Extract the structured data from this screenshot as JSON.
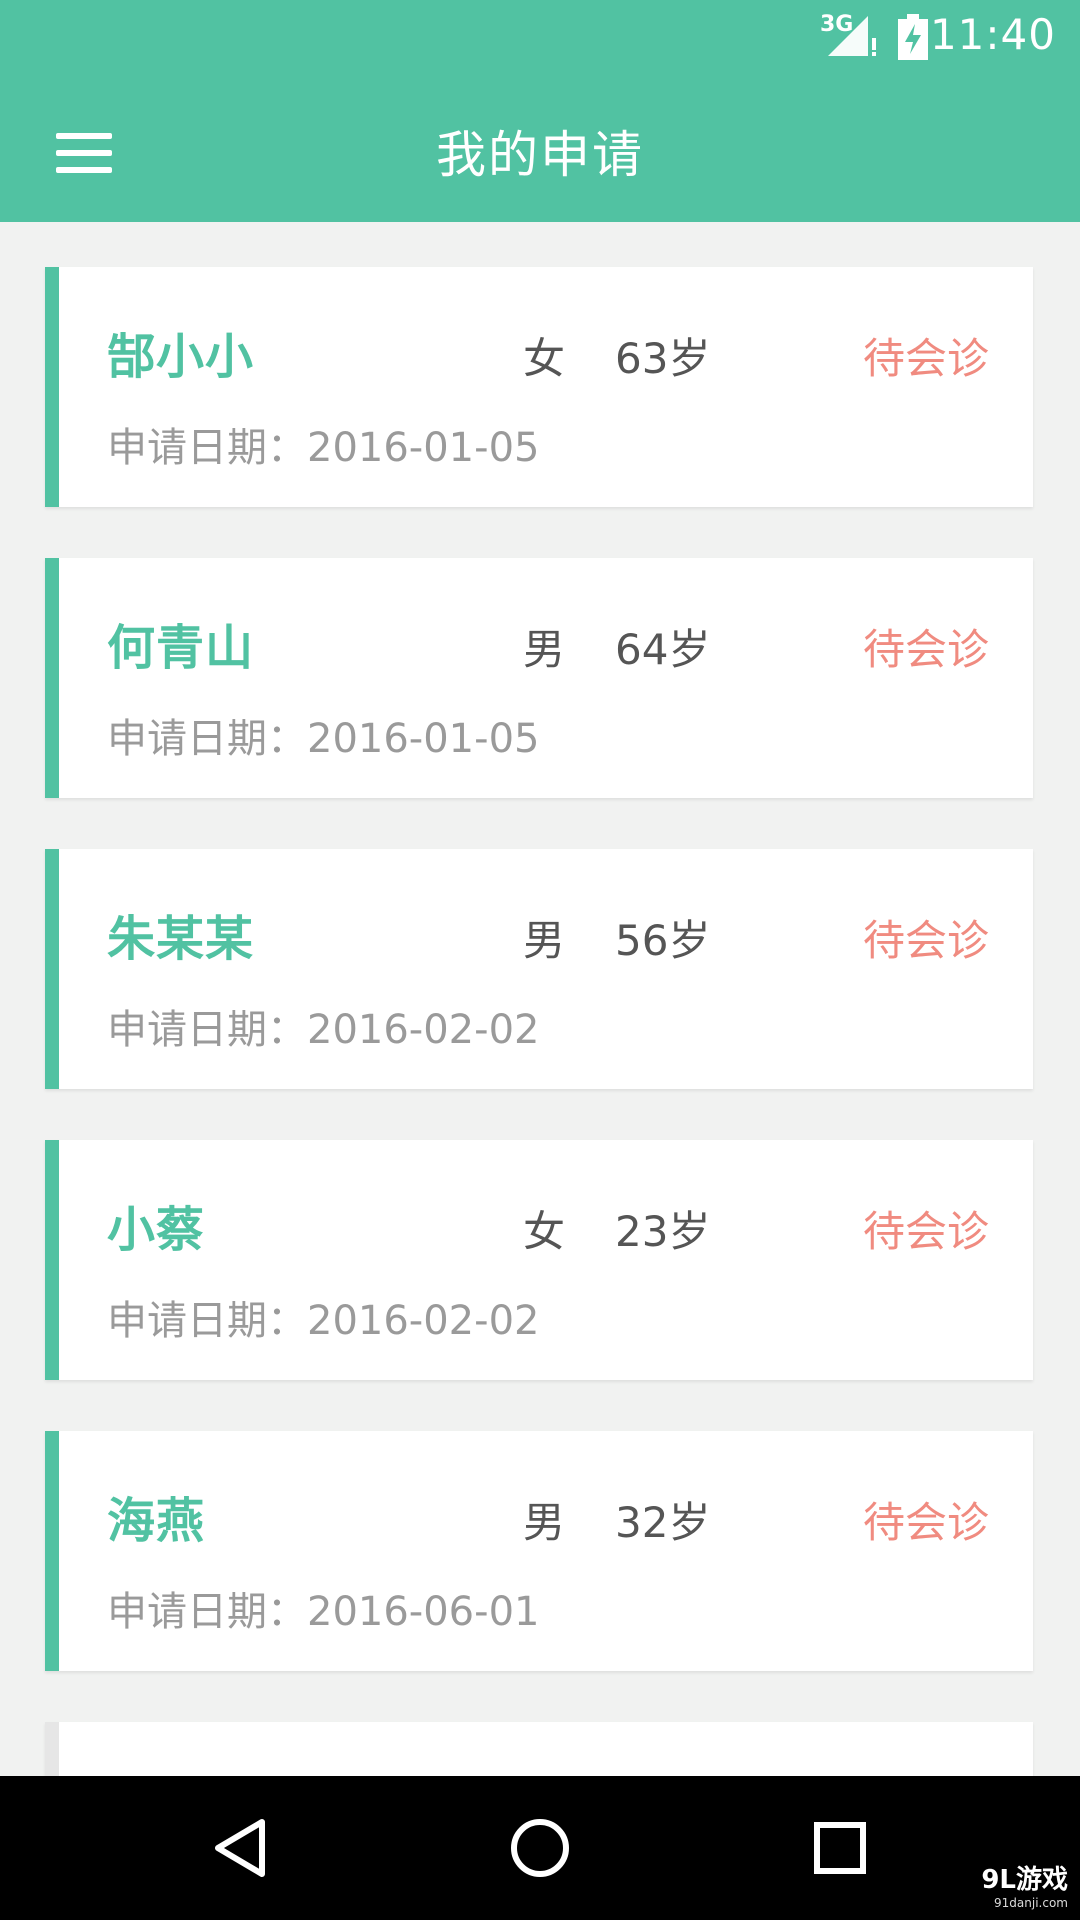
{
  "status_bar": {
    "network": "3G",
    "time": "11:40"
  },
  "app_bar": {
    "title": "我的申请",
    "menu_icon": "hamburger-menu-icon"
  },
  "date_label": "申请日期：",
  "applications": [
    {
      "name": "郜小小",
      "gender": "女",
      "age": "63岁",
      "status": "待会诊",
      "date": "2016-01-05"
    },
    {
      "name": "何青山",
      "gender": "男",
      "age": "64岁",
      "status": "待会诊",
      "date": "2016-01-05"
    },
    {
      "name": "朱某某",
      "gender": "男",
      "age": "56岁",
      "status": "待会诊",
      "date": "2016-02-02"
    },
    {
      "name": "小蔡",
      "gender": "女",
      "age": "23岁",
      "status": "待会诊",
      "date": "2016-02-02"
    },
    {
      "name": "海燕",
      "gender": "男",
      "age": "32岁",
      "status": "待会诊",
      "date": "2016-06-01"
    }
  ],
  "nav_bar": {
    "back_icon": "back-triangle-icon",
    "home_icon": "home-circle-icon",
    "recents_icon": "recents-square-icon"
  },
  "watermark": {
    "brand": "9L游戏",
    "url": "91danji.com"
  },
  "colors": {
    "primary": "#51c2a2",
    "status": "#f08b80",
    "background": "#f1f2f1"
  }
}
